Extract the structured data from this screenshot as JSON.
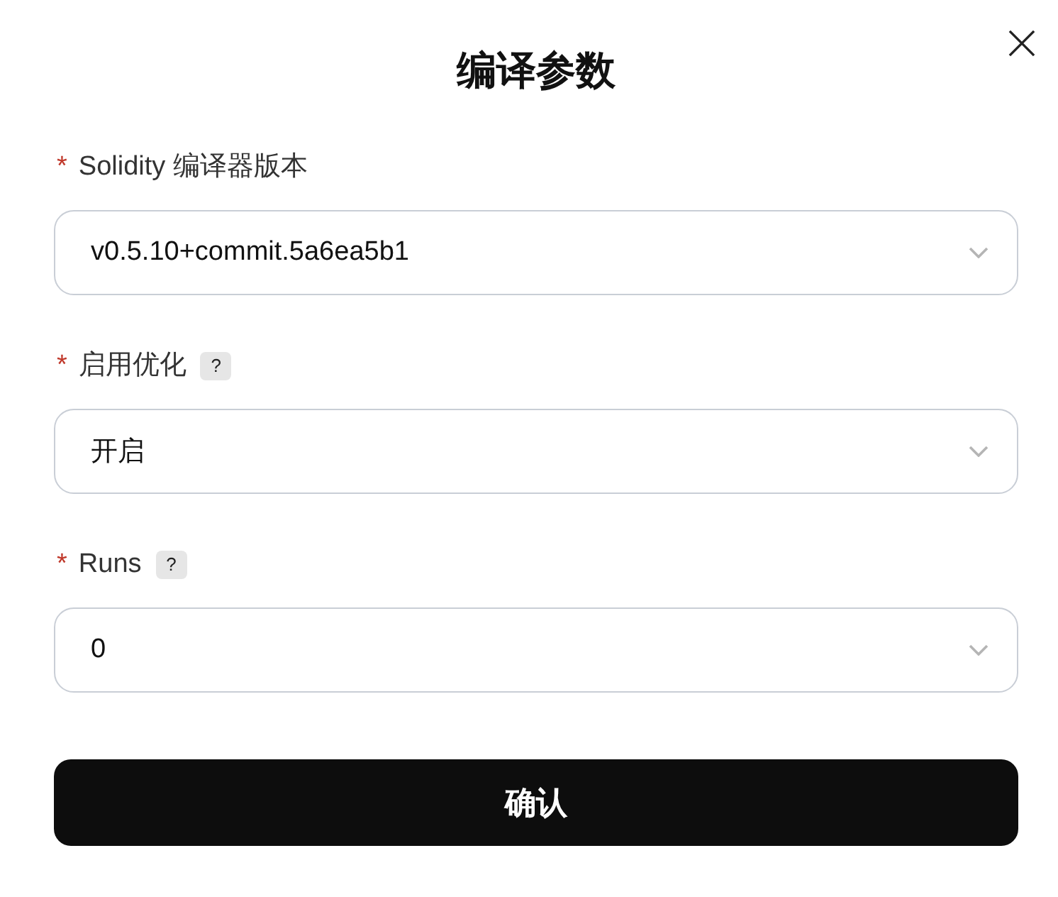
{
  "dialog": {
    "title": "编译参数"
  },
  "fields": [
    {
      "required_mark": "*",
      "label": "Solidity 编译器版本",
      "value": "v0.5.10+commit.5a6ea5b1"
    },
    {
      "required_mark": "*",
      "label": "启用优化",
      "help": "?",
      "value": "开启"
    },
    {
      "required_mark": "*",
      "label": "Runs",
      "help": "?",
      "value": "0"
    }
  ],
  "submit": "确认"
}
